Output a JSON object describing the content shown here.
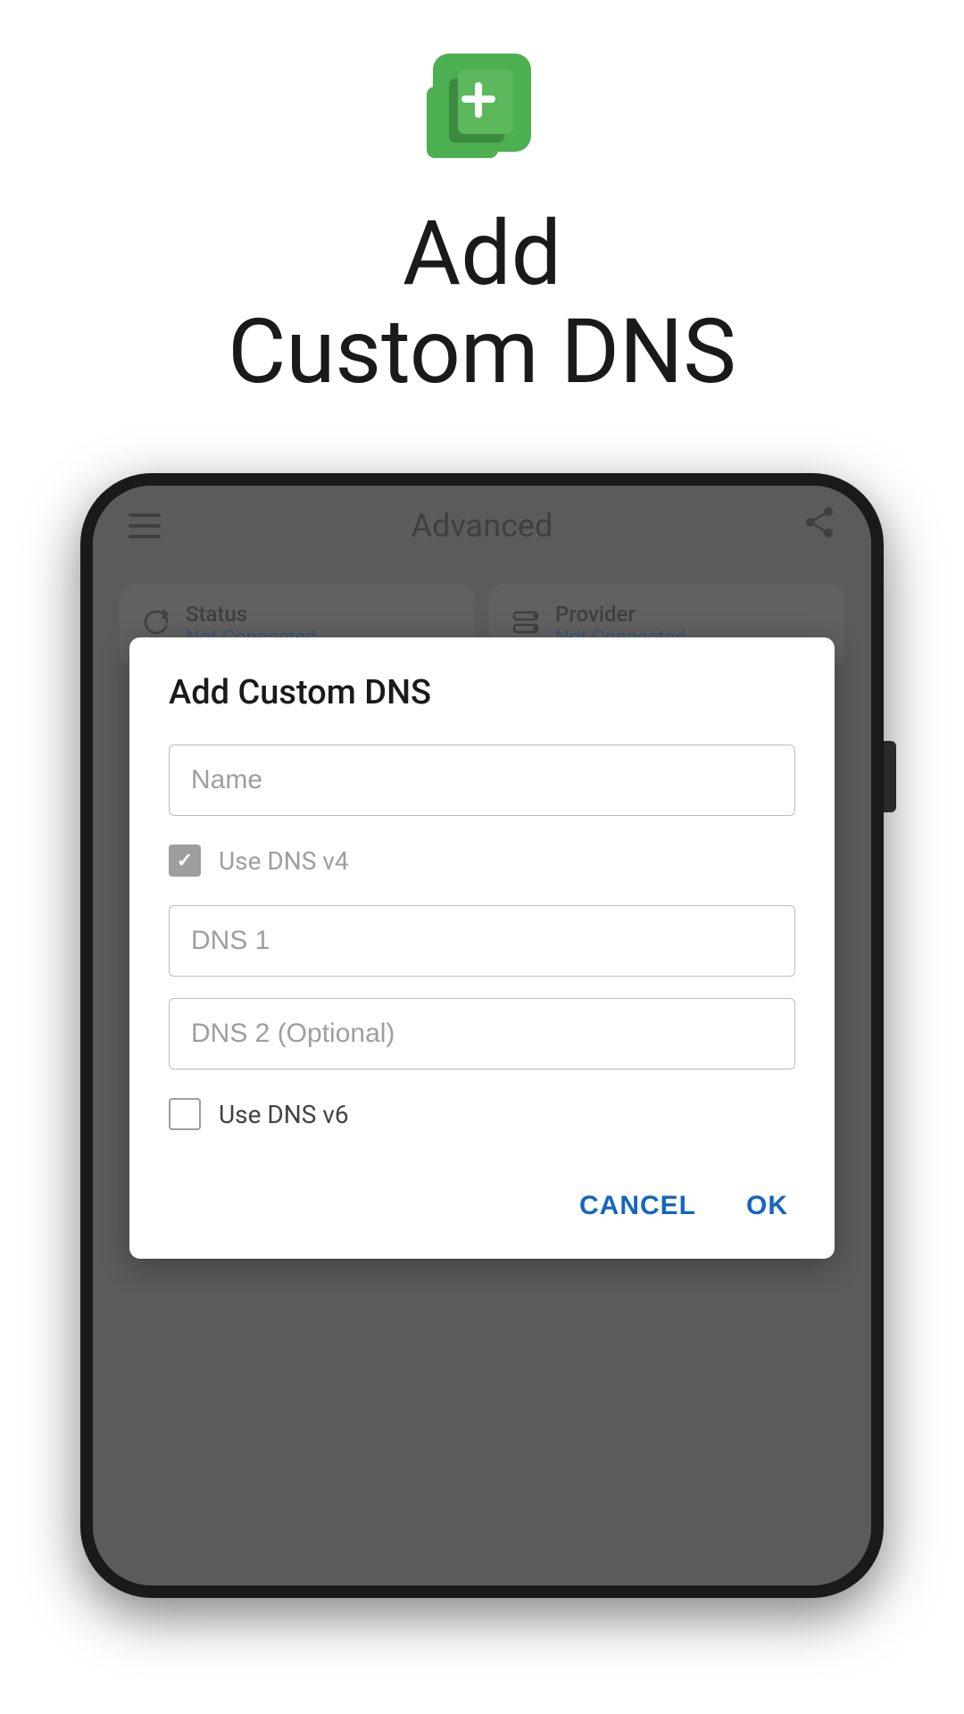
{
  "app": {
    "icon_label": "add-content-icon",
    "title_line1": "Add",
    "title_line2": "Custom DNS"
  },
  "phone": {
    "appbar": {
      "title": "Advanced",
      "hamburger_label": "menu-icon",
      "share_label": "share-icon"
    },
    "status_cards": [
      {
        "label": "Status",
        "value": "Not Connected",
        "icon": "refresh-icon"
      },
      {
        "label": "Provider",
        "value": "Not Connected",
        "icon": "server-icon"
      }
    ],
    "dialog": {
      "title": "Add Custom DNS",
      "name_placeholder": "Name",
      "dns_v4_checkbox_label": "Use DNS v4",
      "dns_v4_checked": true,
      "dns1_placeholder": "DNS 1",
      "dns2_placeholder": "DNS 2 (Optional)",
      "dns_v6_checkbox_label": "Use DNS v6",
      "dns_v6_checked": false,
      "cancel_label": "CANCEL",
      "ok_label": "OK"
    }
  }
}
